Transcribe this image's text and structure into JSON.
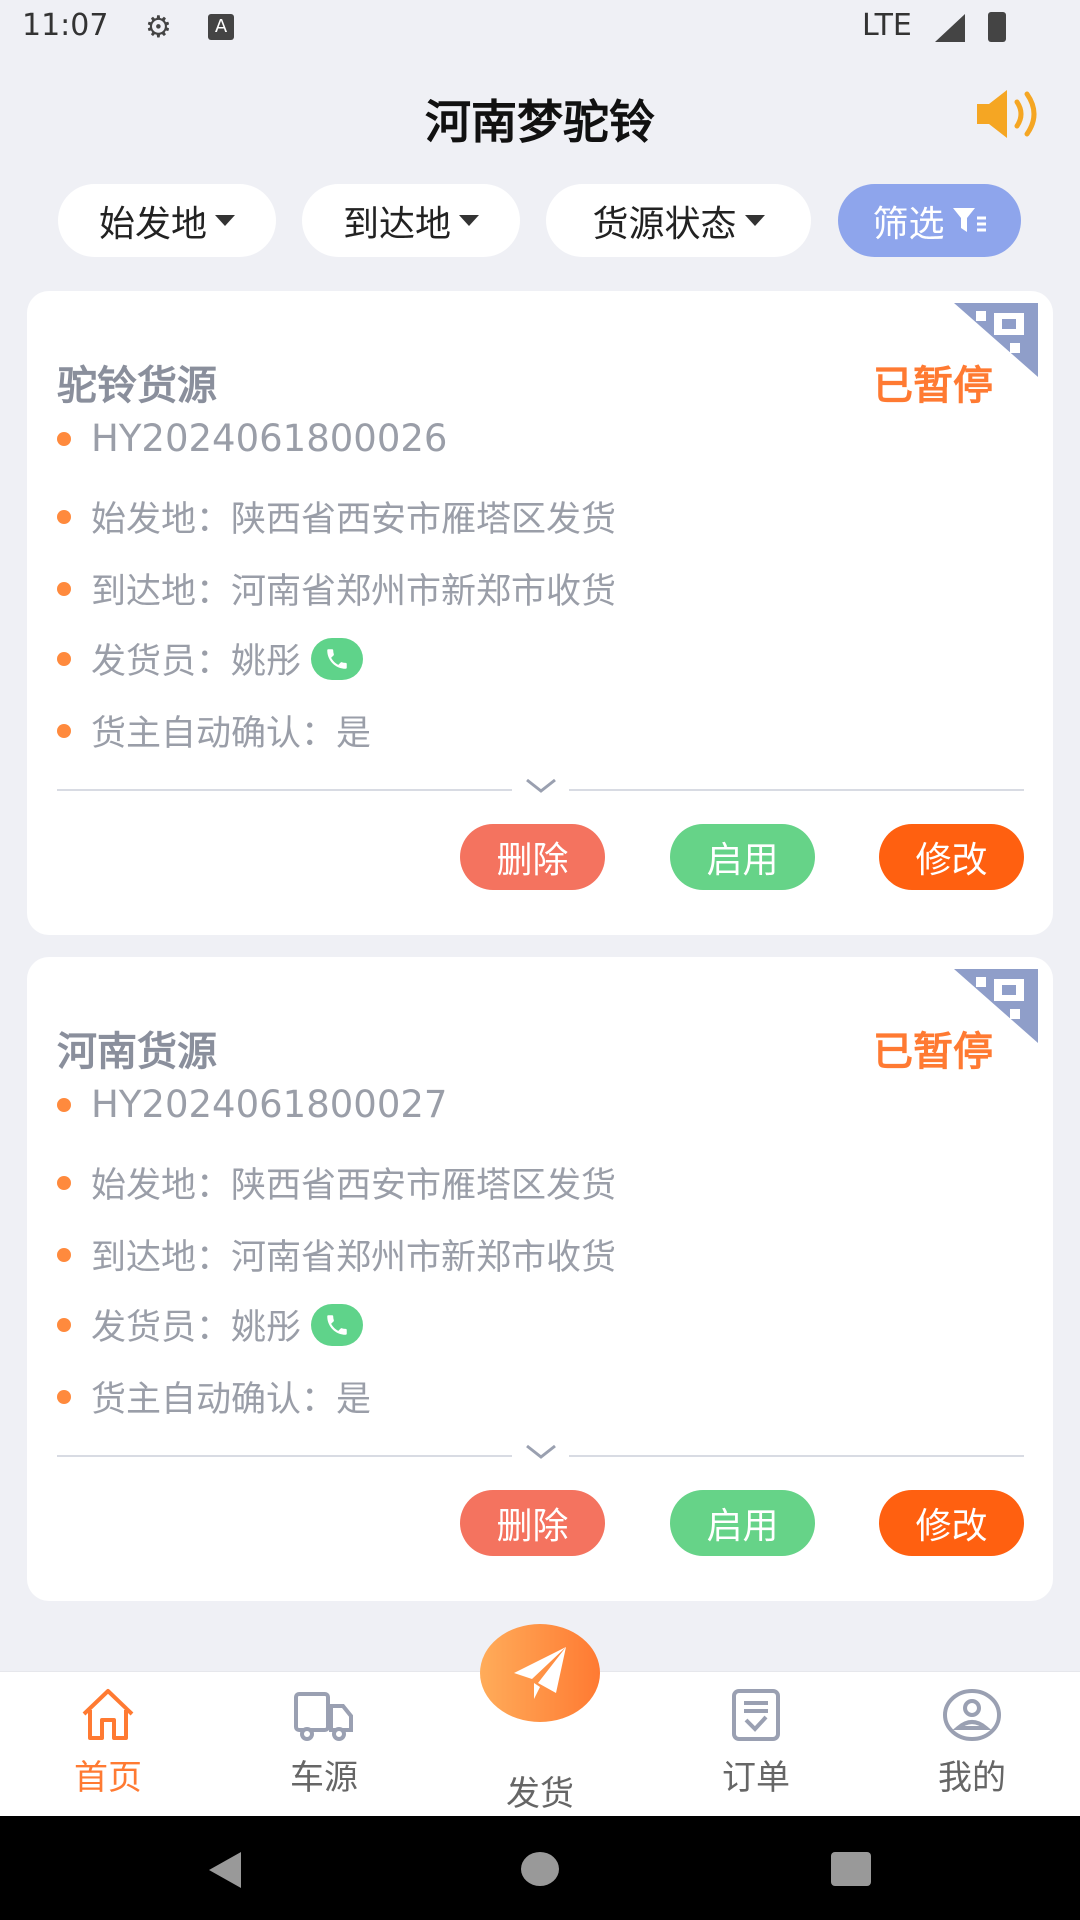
{
  "status_bar": {
    "time": "11:07",
    "network": "LTE"
  },
  "header": {
    "title": "河南梦驼铃",
    "speaker_icon": "speaker-icon"
  },
  "filters": [
    {
      "label": "始发地"
    },
    {
      "label": "到达地"
    },
    {
      "label": "货源状态"
    },
    {
      "label": "筛选"
    }
  ],
  "colors": {
    "accent": "#ff7a32",
    "filter_active": "#8ea5ec",
    "delete": "#f4735f",
    "enable": "#66d388",
    "edit": "#ff6010"
  },
  "cards": [
    {
      "title": "驼铃货源",
      "status": "已暂停",
      "id": "HY2024061800026",
      "origin": "始发地：陕西省西安市雁塔区发货",
      "dest": "到达地：河南省郑州市新郑市收货",
      "shipper": "发货员：姚彤",
      "auto": "货主自动确认：是",
      "delete": "删除",
      "enable": "启用",
      "edit": "修改"
    },
    {
      "title": "河南货源",
      "status": "已暂停",
      "id": "HY2024061800027",
      "origin": "始发地：陕西省西安市雁塔区发货",
      "dest": "到达地：河南省郑州市新郑市收货",
      "shipper": "发货员：姚彤",
      "auto": "货主自动确认：是",
      "delete": "删除",
      "enable": "启用",
      "edit": "修改"
    }
  ],
  "nav": [
    {
      "label": "首页",
      "icon": "home-icon"
    },
    {
      "label": "车源",
      "icon": "truck-icon"
    },
    {
      "label": "发货",
      "icon": "paper-plane-icon"
    },
    {
      "label": "订单",
      "icon": "order-icon"
    },
    {
      "label": "我的",
      "icon": "user-icon"
    }
  ]
}
